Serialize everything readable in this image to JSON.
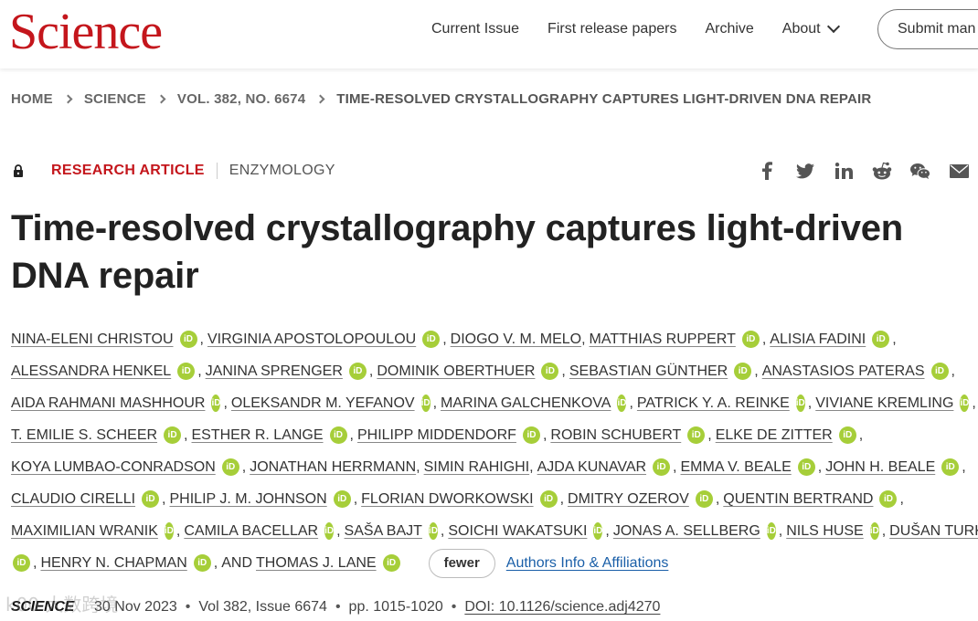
{
  "header": {
    "logo_text": "Science",
    "nav": [
      "Current Issue",
      "First release papers",
      "Archive"
    ],
    "about_label": "About",
    "submit_label": "Submit man"
  },
  "breadcrumb": [
    "HOME",
    "SCIENCE",
    "VOL. 382, NO. 6674",
    "TIME-RESOLVED CRYSTALLOGRAPHY CAPTURES LIGHT-DRIVEN DNA REPAIR"
  ],
  "article": {
    "type": "RESEARCH ARTICLE",
    "subject": "ENZYMOLOGY",
    "title_line1": "Time-resolved crystallography captures light-driven",
    "title_line2": "DNA repair",
    "share_icons": [
      "facebook-icon",
      "twitter-icon",
      "linkedin-icon",
      "reddit-icon",
      "wechat-icon",
      "email-icon"
    ]
  },
  "authors": [
    [
      "NINA-ELENI CHRISTOU",
      "VIRGINIA APOSTOLOPOULOU",
      "DIOGO V. M. MELO",
      "MATTHIAS RUPPERT",
      "ALISIA FADINI"
    ],
    [
      "ALESSANDRA HENKEL",
      "JANINA SPRENGER",
      "DOMINIK OBERTHUER",
      "SEBASTIAN GÜNTHER",
      "ANASTASIOS PATERAS"
    ],
    [
      "AIDA RAHMANI MASHHOUR",
      "OLEKSANDR M. YEFANOV",
      "MARINA GALCHENKOVA",
      "PATRICK Y. A. REINKE",
      "VIVIANE KREMLING"
    ],
    [
      "T. EMILIE S. SCHEER",
      "ESTHER R. LANGE",
      "PHILIPP MIDDENDORF",
      "ROBIN SCHUBERT",
      "ELKE DE ZITTER"
    ],
    [
      "KOYA LUMBAO-CONRADSON",
      "JONATHAN HERRMANN",
      "SIMIN RAHIGHI",
      "AJDA KUNAVAR",
      "EMMA V. BEALE",
      "JOHN H. BEALE"
    ],
    [
      "CLAUDIO CIRELLI",
      "PHILIP J. M. JOHNSON",
      "FLORIAN DWORKOWSKI",
      "DMITRY OZEROV",
      "QUENTIN BERTRAND"
    ],
    [
      "MAXIMILIAN WRANIK",
      "CAMILA BACELLAR",
      "SAŠA BAJT",
      "SOICHI WAKATSUKI",
      "JONAS A. SELLBERG",
      "NILS HUSE",
      "DUŠAN TURK"
    ],
    [
      "HENRY N. CHAPMAN",
      "THOMAS J. LANE"
    ]
  ],
  "orcid_text": "iD",
  "and_label": "AND",
  "fewer_label": "fewer",
  "affiliations_label": "Authors Info & Affiliations",
  "citation": {
    "journal": "SCIENCE",
    "date": "30 Nov 2023",
    "volume": "Vol 382, Issue 6674",
    "pages": "pp. 1015-1020",
    "doi": "DOI: 10.1126/science.adj4270"
  },
  "watermark": "k00 大数跨境"
}
